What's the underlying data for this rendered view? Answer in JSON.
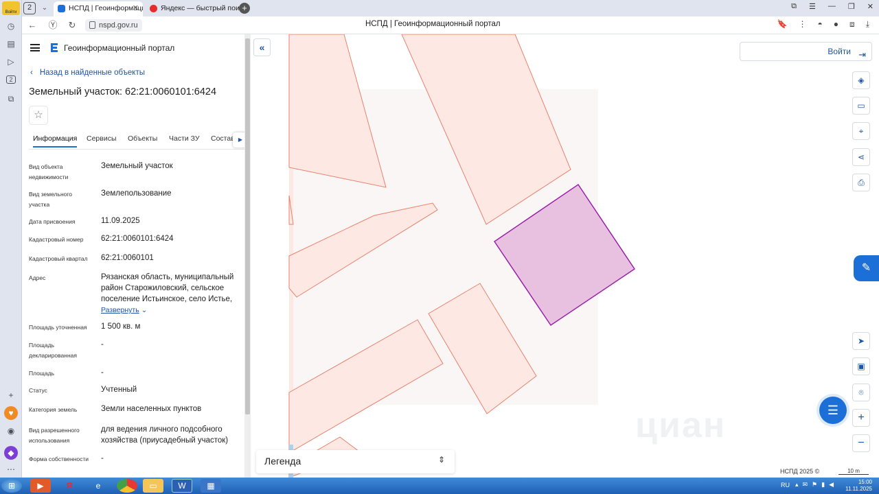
{
  "browser": {
    "login_badge": "Войти",
    "tab_count": "2",
    "tabs": [
      {
        "title": "НСПД | Геоинформационный",
        "active": true
      },
      {
        "title": "Яндекс — быстрый поиск",
        "active": false
      }
    ],
    "url": "nspd.gov.ru",
    "page_title": "НСПД | Геоинформационный портал",
    "sidebar_icons": [
      "clock-icon",
      "bookmarks-icon",
      "play-icon",
      "tab-count-icon",
      "screenshot-icon",
      "add-icon",
      "pet-icon",
      "alice-icon",
      "more-icon"
    ]
  },
  "panel": {
    "portal_name": "Геоинформационный портал",
    "back_label": "Назад в найденные объекты",
    "title": "Земельный участок: 62:21:0060101:6424",
    "tabs": [
      "Информация",
      "Сервисы",
      "Объекты",
      "Части ЗУ",
      "Состав"
    ],
    "fields": [
      {
        "label": "Вид объекта недвижимости",
        "value": "Земельный участок"
      },
      {
        "label": "Вид земельного участка",
        "value": "Землепользование"
      },
      {
        "label": "Дата присвоения",
        "value": "11.09.2025"
      },
      {
        "label": "Кадастровый номер",
        "value": "62:21:0060101:6424"
      },
      {
        "label": "Кадастровый квартал",
        "value": "62:21:0060101"
      },
      {
        "label": "Адрес",
        "value": "Рязанская область, муниципальный район Старожиловский, сельское поселение Истьинское, село Истье,"
      },
      {
        "label": "Площадь уточненная",
        "value": "1 500 кв. м"
      },
      {
        "label": "Площадь декларированная",
        "value": "-"
      },
      {
        "label": "Площадь",
        "value": "-"
      },
      {
        "label": "Статус",
        "value": "Учтенный"
      },
      {
        "label": "Категория земель",
        "value": "Земли населенных пунктов"
      },
      {
        "label": "Вид разрешенного использования",
        "value": "для ведения личного подсобного хозяйства (приусадебный участок)"
      },
      {
        "label": "Форма собственности",
        "value": "-"
      }
    ],
    "expand_label": "Развернуть"
  },
  "map": {
    "login_label": "Войти",
    "legend_label": "Легенда",
    "copyright": "НСПД 2025 ©",
    "scale_label": "10 m",
    "watermark": "циан",
    "tools": [
      "layers-icon",
      "ruler-icon",
      "select-area-icon",
      "share-icon",
      "print-icon"
    ],
    "nav_tools": [
      "locate-icon",
      "minimap-icon",
      "geo-pin-icon",
      "zoom-in-icon",
      "zoom-out-icon"
    ]
  },
  "taskbar": {
    "lang": "RU",
    "time": "15:00",
    "date": "11.11.2025"
  },
  "colors": {
    "accent": "#1c6fd6",
    "parcel_fill": "#fde8e4",
    "parcel_stroke": "#e8826a",
    "selected_fill": "#e8c0e0",
    "selected_stroke": "#9a22a8"
  }
}
